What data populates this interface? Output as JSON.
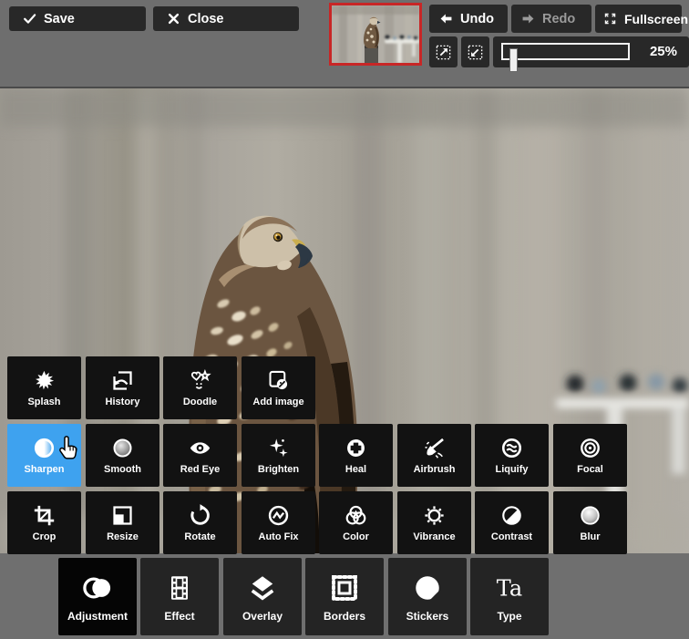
{
  "topbar": {
    "save_label": "Save",
    "close_label": "Close",
    "undo_label": "Undo",
    "redo_label": "Redo",
    "redo_disabled": true,
    "fullscreen_label": "Fullscreen",
    "zoom_percent": "25%"
  },
  "tools": {
    "rows": [
      [
        {
          "id": "splash",
          "label": "Splash",
          "icon": "splash"
        },
        {
          "id": "history",
          "label": "History",
          "icon": "history"
        },
        {
          "id": "doodle",
          "label": "Doodle",
          "icon": "doodle"
        },
        {
          "id": "add-image",
          "label": "Add image",
          "icon": "add-image"
        }
      ],
      [
        {
          "id": "sharpen",
          "label": "Sharpen",
          "icon": "sharpen",
          "selected": true
        },
        {
          "id": "smooth",
          "label": "Smooth",
          "icon": "smooth"
        },
        {
          "id": "red-eye",
          "label": "Red Eye",
          "icon": "red-eye"
        },
        {
          "id": "brighten",
          "label": "Brighten",
          "icon": "brighten"
        },
        {
          "id": "heal",
          "label": "Heal",
          "icon": "heal"
        },
        {
          "id": "airbrush",
          "label": "Airbrush",
          "icon": "airbrush"
        },
        {
          "id": "liquify",
          "label": "Liquify",
          "icon": "liquify"
        },
        {
          "id": "focal",
          "label": "Focal",
          "icon": "focal"
        }
      ],
      [
        {
          "id": "crop",
          "label": "Crop",
          "icon": "crop"
        },
        {
          "id": "resize",
          "label": "Resize",
          "icon": "resize"
        },
        {
          "id": "rotate",
          "label": "Rotate",
          "icon": "rotate"
        },
        {
          "id": "auto-fix",
          "label": "Auto Fix",
          "icon": "auto-fix"
        },
        {
          "id": "color",
          "label": "Color",
          "icon": "color"
        },
        {
          "id": "vibrance",
          "label": "Vibrance",
          "icon": "vibrance"
        },
        {
          "id": "contrast",
          "label": "Contrast",
          "icon": "contrast"
        },
        {
          "id": "blur",
          "label": "Blur",
          "icon": "blur"
        }
      ]
    ]
  },
  "categories": [
    {
      "id": "adjustment",
      "label": "Adjustment",
      "icon": "adjustment",
      "active": true
    },
    {
      "id": "effect",
      "label": "Effect",
      "icon": "effect"
    },
    {
      "id": "overlay",
      "label": "Overlay",
      "icon": "overlay"
    },
    {
      "id": "borders",
      "label": "Borders",
      "icon": "borders"
    },
    {
      "id": "stickers",
      "label": "Stickers",
      "icon": "stickers"
    },
    {
      "id": "type",
      "label": "Type",
      "icon": "type"
    }
  ],
  "colors": {
    "accent_blue": "#3ea2ef",
    "thumbnail_border": "#c82626",
    "topbar_bg": "#6e6e6e",
    "tile_bg": "#121212",
    "category_bg": "#242424",
    "category_active_bg": "#050505"
  }
}
